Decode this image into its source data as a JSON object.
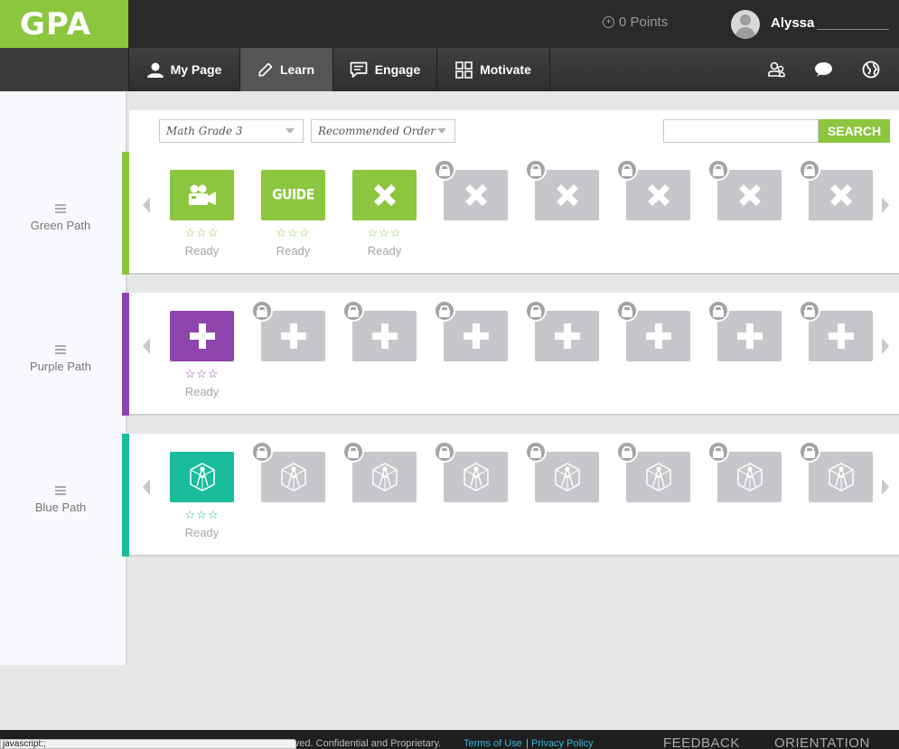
{
  "app": {
    "logo": "GPA"
  },
  "header": {
    "points_label": "0 Points",
    "username": "Alyssa"
  },
  "nav": {
    "items": [
      {
        "label": "My Page",
        "icon": "user-icon",
        "active": false
      },
      {
        "label": "Learn",
        "icon": "pencil-icon",
        "active": true
      },
      {
        "label": "Engage",
        "icon": "chat-bubble-icon",
        "active": false
      },
      {
        "label": "Motivate",
        "icon": "grid-icon",
        "active": false
      }
    ],
    "right_icons": [
      "users-icon",
      "speech-bubble-icon",
      "globe-icon"
    ]
  },
  "sidebar": {
    "items": [
      {
        "label": "Green Path"
      },
      {
        "label": "Purple Path"
      },
      {
        "label": "Blue Path"
      }
    ]
  },
  "filters": {
    "subject": "Math Grade 3",
    "order": "Recommended Order",
    "search_placeholder": "",
    "search_button": "SEARCH"
  },
  "paths": [
    {
      "name": "Green Path",
      "color": "#8cc63f",
      "tiles": [
        {
          "type": "video",
          "icon": "video-camera-icon",
          "locked": false,
          "status": "Ready"
        },
        {
          "type": "guide",
          "label": "GUIDE",
          "locked": false,
          "status": "Ready"
        },
        {
          "type": "x",
          "icon": "x-icon",
          "locked": false,
          "status": "Ready"
        },
        {
          "type": "x",
          "icon": "x-icon",
          "locked": true
        },
        {
          "type": "x",
          "icon": "x-icon",
          "locked": true
        },
        {
          "type": "x",
          "icon": "x-icon",
          "locked": true
        },
        {
          "type": "x",
          "icon": "x-icon",
          "locked": true
        },
        {
          "type": "x",
          "icon": "x-icon",
          "locked": true
        }
      ]
    },
    {
      "name": "Purple Path",
      "color": "#8e44ad",
      "tiles": [
        {
          "type": "plus",
          "icon": "plus-icon",
          "locked": false,
          "status": "Ready"
        },
        {
          "type": "plus",
          "icon": "plus-icon",
          "locked": true
        },
        {
          "type": "plus",
          "icon": "plus-icon",
          "locked": true
        },
        {
          "type": "plus",
          "icon": "plus-icon",
          "locked": true
        },
        {
          "type": "plus",
          "icon": "plus-icon",
          "locked": true
        },
        {
          "type": "plus",
          "icon": "plus-icon",
          "locked": true
        },
        {
          "type": "plus",
          "icon": "plus-icon",
          "locked": true
        },
        {
          "type": "plus",
          "icon": "plus-icon",
          "locked": true
        }
      ]
    },
    {
      "name": "Blue Path",
      "color": "#1abc9c",
      "tiles": [
        {
          "type": "cube",
          "icon": "geometry-cube-icon",
          "locked": false,
          "status": "Ready"
        },
        {
          "type": "cube",
          "icon": "geometry-cube-icon",
          "locked": true
        },
        {
          "type": "cube",
          "icon": "geometry-cube-icon",
          "locked": true
        },
        {
          "type": "cube",
          "icon": "geometry-cube-icon",
          "locked": true
        },
        {
          "type": "cube",
          "icon": "geometry-cube-icon",
          "locked": true
        },
        {
          "type": "cube",
          "icon": "geometry-cube-icon",
          "locked": true
        },
        {
          "type": "cube",
          "icon": "geometry-cube-icon",
          "locked": true
        },
        {
          "type": "cube",
          "icon": "geometry-cube-icon",
          "locked": true
        }
      ]
    }
  ],
  "stars_text": "☆☆☆",
  "footer": {
    "copyright": "erved. Confidential and Proprietary.",
    "terms": "Terms of Use",
    "separator": "|",
    "privacy": "Privacy Policy",
    "feedback": "FEEDBACK",
    "orientation": "ORIENTATION"
  },
  "status_bar": "javascript:;"
}
